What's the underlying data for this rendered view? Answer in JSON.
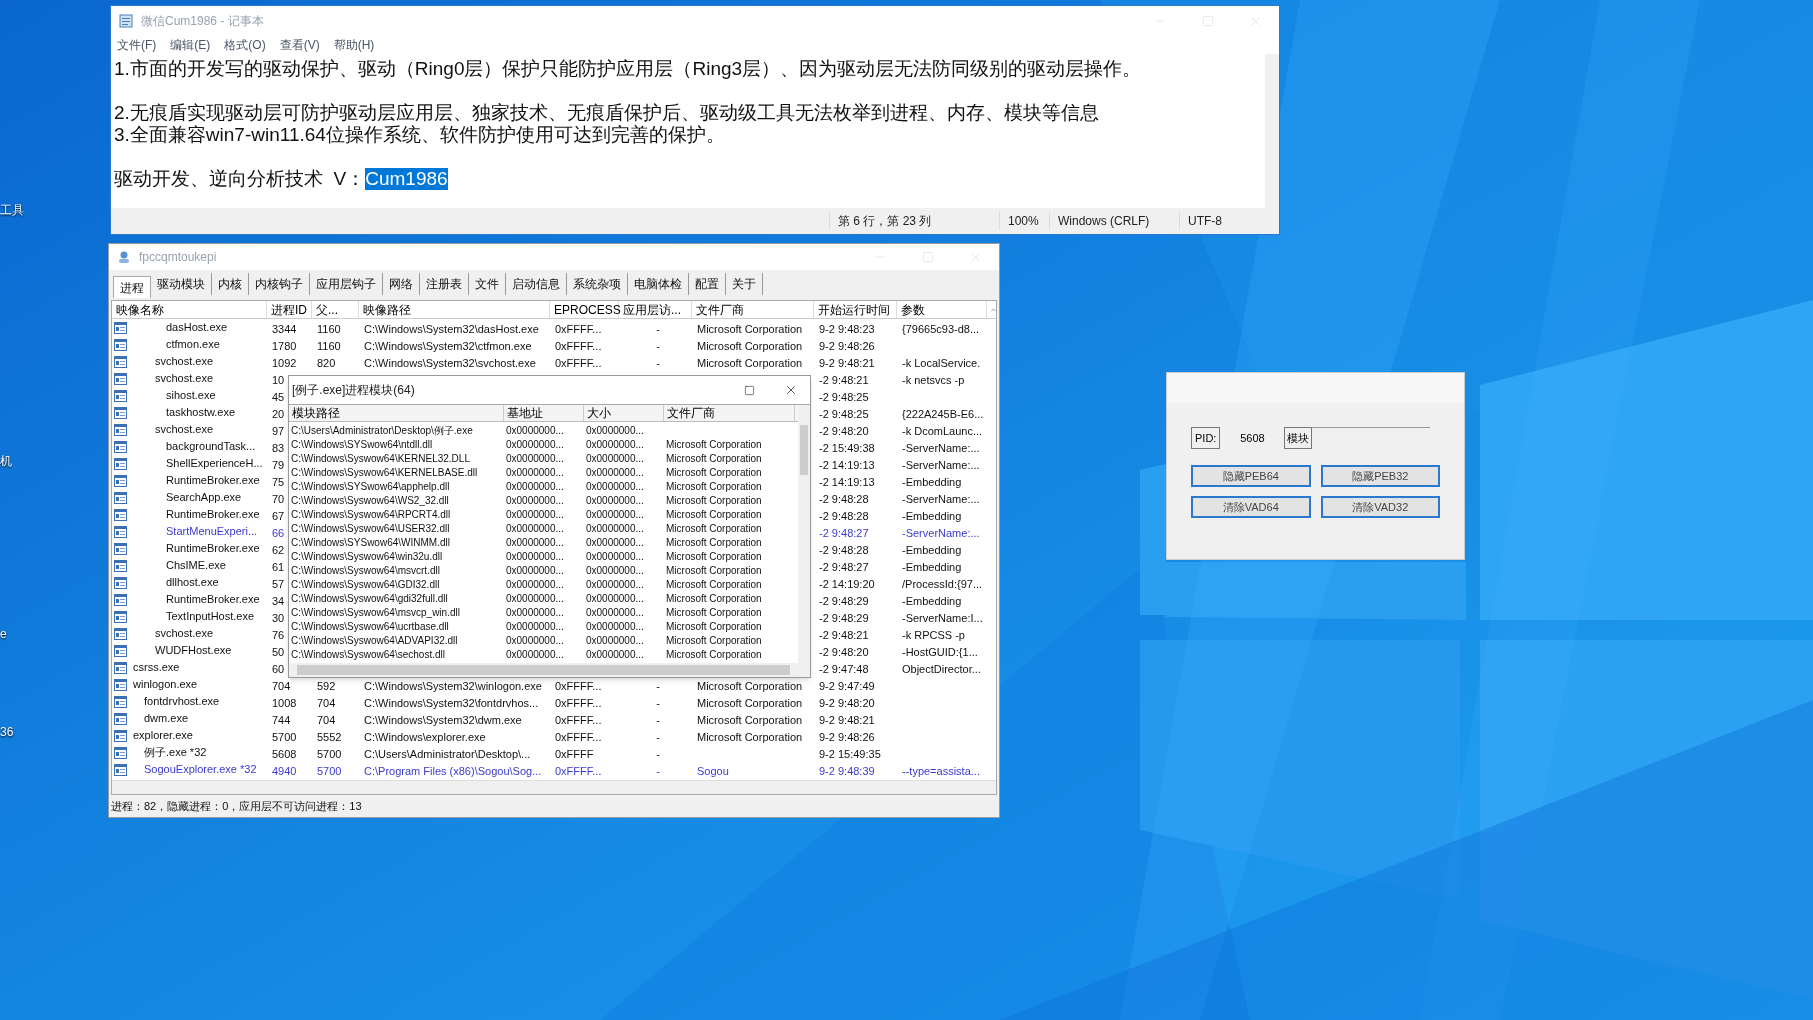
{
  "desktop_icons": [
    {
      "label": "工具"
    },
    {
      "label": "机"
    },
    {
      "label": "e"
    },
    {
      "label": "36"
    }
  ],
  "notepad": {
    "title": "微信Cum1986 - 记事本",
    "menu": [
      "文件(F)",
      "编辑(E)",
      "格式(O)",
      "查看(V)",
      "帮助(H)"
    ],
    "paragraphs": [
      [
        {
          "text": "1.市面的开发写的驱动保护、驱动（Ring0层）保护只能防护应用层（Ring3层）、因为驱动层无法防同级别的驱动层操作。"
        }
      ],
      [
        {
          "text": "2.无痕盾实现驱动层可防护驱动层应用层、独家技术、无痕盾保护后、驱动级工具无法枚举到进程、内存、模块等信息"
        },
        {
          "text": "3.全面兼容win7-win11.64位操作系统、软件防护使用可达到完善的保护。"
        }
      ],
      [
        {
          "text": "驱动开发、逆向分析技术  V：",
          "selection": "Cum1986"
        }
      ]
    ],
    "status": [
      "第 6 行，第 23 列",
      "100%",
      "Windows (CRLF)",
      "UTF-8"
    ]
  },
  "process_window": {
    "title": "fpccqmtoukepi",
    "tabs": [
      {
        "label": "进程",
        "selected": true
      },
      {
        "label": "驱动模块",
        "selected": false
      },
      {
        "label": "内核",
        "selected": false
      },
      {
        "label": "内核钩子",
        "selected": false
      },
      {
        "label": "应用层钩子",
        "selected": false
      },
      {
        "label": "网络",
        "selected": false
      },
      {
        "label": "注册表",
        "selected": false
      },
      {
        "label": "文件",
        "selected": false
      },
      {
        "label": "启动信息",
        "selected": false
      },
      {
        "label": "系统杂项",
        "selected": false
      },
      {
        "label": "电脑体检",
        "selected": false
      },
      {
        "label": "配置",
        "selected": false
      },
      {
        "label": "关于",
        "selected": false
      }
    ],
    "columns": [
      "映像名称",
      "进程ID",
      "父...",
      "映像路径",
      "EPROCESS",
      "应用层访...",
      "文件厂商",
      "开始运行时间",
      "参数"
    ],
    "rows": [
      {
        "children": [
          {
            "children": [
              {
                "children": [
                  {
                    "name": "dasHost.exe",
                    "pid": "3344",
                    "ppid": "1160",
                    "path": "C:\\Windows\\System32\\dasHost.exe",
                    "eprocess": "0xFFFF...",
                    "access": "-",
                    "vendor": "Microsoft Corporation",
                    "time": "9-2 9:48:23",
                    "param": "{79665c93-d8..."
                  },
                  {
                    "name": "ctfmon.exe",
                    "pid": "1780",
                    "ppid": "1160",
                    "path": "C:\\Windows\\System32\\ctfmon.exe",
                    "eprocess": "0xFFFF...",
                    "access": "-",
                    "vendor": "Microsoft Corporation",
                    "time": "9-2 9:48:26"
                  }
                ]
              },
              {
                "name": "svchost.exe",
                "pid": "1092",
                "ppid": "820",
                "path": "C:\\Windows\\System32\\svchost.exe",
                "eprocess": "0xFFFF...",
                "access": "-",
                "vendor": "Microsoft Corporation",
                "time": "9-2 9:48:21",
                "param": "-k LocalService."
              },
              {
                "name": "svchost.exe",
                "pid": "10",
                "time": "-2 9:48:21",
                "param": "-k netsvcs -p",
                "children": [
                  {
                    "name": "sihost.exe",
                    "pid": "45",
                    "time": "-2 9:48:25"
                  },
                  {
                    "name": "taskhostw.exe",
                    "pid": "20",
                    "time": "-2 9:48:25",
                    "param": "{222A245B-E6..."
                  }
                ]
              },
              {
                "name": "svchost.exe",
                "pid": "97",
                "time": "-2 9:48:20",
                "param": "-k DcomLaunc...",
                "children": [
                  {
                    "name": "backgroundTask...",
                    "pid": "83",
                    "time": "-2 15:49:38",
                    "param": "-ServerName:..."
                  },
                  {
                    "name": "ShellExperienceH...",
                    "pid": "79",
                    "time": "-2 14:19:13",
                    "param": "-ServerName:..."
                  },
                  {
                    "name": "RuntimeBroker.exe",
                    "pid": "75",
                    "time": "-2 14:19:13",
                    "param": "-Embedding"
                  },
                  {
                    "name": "SearchApp.exe",
                    "pid": "70",
                    "time": "-2 9:48:28",
                    "param": "-ServerName:..."
                  },
                  {
                    "name": "RuntimeBroker.exe",
                    "pid": "67",
                    "time": "-2 9:48:28",
                    "param": "-Embedding"
                  },
                  {
                    "name": "StartMenuExperi...",
                    "pid": "66",
                    "time": "-2 9:48:27",
                    "param": "-ServerName:...",
                    "color": "#3a3ad0"
                  },
                  {
                    "name": "RuntimeBroker.exe",
                    "pid": "62",
                    "time": "-2 9:48:28",
                    "param": "-Embedding"
                  },
                  {
                    "name": "ChsIME.exe",
                    "pid": "61",
                    "time": "-2 9:48:27",
                    "param": "-Embedding"
                  },
                  {
                    "name": "dllhost.exe",
                    "pid": "57",
                    "time": "-2 14:19:20",
                    "param": "/ProcessId:{97..."
                  },
                  {
                    "name": "RuntimeBroker.exe",
                    "pid": "34",
                    "time": "-2 9:48:29",
                    "param": "-Embedding"
                  },
                  {
                    "name": "TextInputHost.exe",
                    "pid": "30",
                    "time": "-2 9:48:29",
                    "param": "-ServerName:I..."
                  }
                ]
              },
              {
                "name": "svchost.exe",
                "pid": "76",
                "time": "-2 9:48:21",
                "param": "-k RPCSS -p"
              },
              {
                "name": "WUDFHost.exe",
                "pid": "50",
                "time": "-2 9:48:20",
                "param": "-HostGUID:{1..."
              }
            ]
          }
        ]
      },
      {
        "name": "csrss.exe",
        "pid": "60",
        "time": "-2 9:47:48",
        "param": "ObjectDirector..."
      },
      {
        "name": "winlogon.exe",
        "pid": "704",
        "ppid": "592",
        "path": "C:\\Windows\\System32\\winlogon.exe",
        "eprocess": "0xFFFF...",
        "access": "-",
        "vendor": "Microsoft Corporation",
        "time": "9-2 9:47:49",
        "children": [
          {
            "name": "fontdrvhost.exe",
            "pid": "1008",
            "ppid": "704",
            "path": "C:\\Windows\\System32\\fontdrvhos...",
            "eprocess": "0xFFFF...",
            "access": "-",
            "vendor": "Microsoft Corporation",
            "time": "9-2 9:48:20"
          },
          {
            "name": "dwm.exe",
            "pid": "744",
            "ppid": "704",
            "path": "C:\\Windows\\System32\\dwm.exe",
            "eprocess": "0xFFFF...",
            "access": "-",
            "vendor": "Microsoft Corporation",
            "time": "9-2 9:48:21"
          }
        ]
      },
      {
        "name": "explorer.exe",
        "pid": "5700",
        "ppid": "5552",
        "path": "C:\\Windows\\explorer.exe",
        "eprocess": "0xFFFF...",
        "access": "-",
        "vendor": "Microsoft Corporation",
        "time": "9-2 9:48:26",
        "children": [
          {
            "name": "例子.exe *32",
            "pid": "5608",
            "ppid": "5700",
            "path": "C:\\Users\\Administrator\\Desktop\\...",
            "eprocess": "0xFFFF",
            "access": "-",
            "time": "9-2 15:49:35"
          },
          {
            "name": "SogouExplorer.exe *32",
            "pid": "4940",
            "ppid": "5700",
            "path": "C:\\Program Files (x86)\\Sogou\\Sog...",
            "eprocess": "0xFFFF...",
            "access": "-",
            "vendor": "Sogou",
            "time": "9-2 9:48:39",
            "param": "--type=assista...",
            "color": "#3a3ad0"
          }
        ]
      }
    ],
    "status": "进程：82，隐藏进程：0，应用层不可访问进程：13"
  },
  "module_dialog": {
    "title": "[例子.exe]进程模块(64)",
    "columns": [
      "模块路径",
      "基地址",
      "大小",
      "文件厂商"
    ],
    "rows": [
      {
        "path": "C:\\Users\\Administrator\\Desktop\\例子.exe",
        "base": "0x0000000...",
        "size": "0x0000000..."
      },
      {
        "path": "C:\\Windows\\SYSwow64\\ntdll.dll",
        "base": "0x0000000...",
        "size": "0x0000000...",
        "vendor": "Microsoft Corporation"
      },
      {
        "path": "C:\\Windows\\Syswow64\\KERNEL32.DLL",
        "base": "0x0000000...",
        "size": "0x0000000...",
        "vendor": "Microsoft Corporation"
      },
      {
        "path": "C:\\Windows\\Syswow64\\KERNELBASE.dll",
        "base": "0x0000000...",
        "size": "0x0000000...",
        "vendor": "Microsoft Corporation"
      },
      {
        "path": "C:\\Windows\\SYSwow64\\apphelp.dll",
        "base": "0x0000000...",
        "size": "0x0000000...",
        "vendor": "Microsoft Corporation"
      },
      {
        "path": "C:\\Windows\\Syswow64\\WS2_32.dll",
        "base": "0x0000000...",
        "size": "0x0000000...",
        "vendor": "Microsoft Corporation"
      },
      {
        "path": "C:\\Windows\\Syswow64\\RPCRT4.dll",
        "base": "0x0000000...",
        "size": "0x0000000...",
        "vendor": "Microsoft Corporation"
      },
      {
        "path": "C:\\Windows\\Syswow64\\USER32.dll",
        "base": "0x0000000...",
        "size": "0x0000000...",
        "vendor": "Microsoft Corporation"
      },
      {
        "path": "C:\\Windows\\SYSwow64\\WINMM.dll",
        "base": "0x0000000...",
        "size": "0x0000000...",
        "vendor": "Microsoft Corporation"
      },
      {
        "path": "C:\\Windows\\Syswow64\\win32u.dll",
        "base": "0x0000000...",
        "size": "0x0000000...",
        "vendor": "Microsoft Corporation"
      },
      {
        "path": "C:\\Windows\\Syswow64\\msvcrt.dll",
        "base": "0x0000000...",
        "size": "0x0000000...",
        "vendor": "Microsoft Corporation"
      },
      {
        "path": "C:\\Windows\\Syswow64\\GDI32.dll",
        "base": "0x0000000...",
        "size": "0x0000000...",
        "vendor": "Microsoft Corporation"
      },
      {
        "path": "C:\\Windows\\Syswow64\\gdi32full.dll",
        "base": "0x0000000...",
        "size": "0x0000000...",
        "vendor": "Microsoft Corporation"
      },
      {
        "path": "C:\\Windows\\Syswow64\\msvcp_win.dll",
        "base": "0x0000000...",
        "size": "0x0000000...",
        "vendor": "Microsoft Corporation"
      },
      {
        "path": "C:\\Windows\\Syswow64\\ucrtbase.dll",
        "base": "0x0000000...",
        "size": "0x0000000...",
        "vendor": "Microsoft Corporation"
      },
      {
        "path": "C:\\Windows\\Syswow64\\ADVAPI32.dll",
        "base": "0x0000000...",
        "size": "0x0000000...",
        "vendor": "Microsoft Corporation"
      },
      {
        "path": "C:\\Windows\\Syswow64\\sechost.dll",
        "base": "0x0000000...",
        "size": "0x0000000...",
        "vendor": "Microsoft Corporation"
      }
    ]
  },
  "tool_window": {
    "pid_label": "PID:",
    "pid_value": "5608",
    "module_button": "模块",
    "buttons": [
      "隐藏PEB64",
      "隐藏PEB32",
      "清除VAD64",
      "清除VAD32"
    ]
  }
}
